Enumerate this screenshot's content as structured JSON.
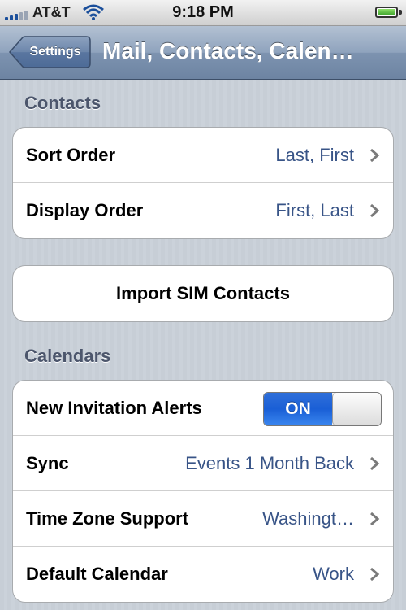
{
  "status_bar": {
    "carrier": "AT&T",
    "time": "9:18 PM",
    "signal_icon": "signal-bars-icon",
    "wifi_icon": "wifi-icon",
    "battery_icon": "battery-charging-icon"
  },
  "nav": {
    "back_label": "Settings",
    "title": "Mail, Contacts, Calen…"
  },
  "contacts_section": {
    "header": "Contacts",
    "rows": [
      {
        "label": "Sort Order",
        "value": "Last, First"
      },
      {
        "label": "Display Order",
        "value": "First, Last"
      }
    ]
  },
  "import_sim": {
    "label": "Import SIM Contacts"
  },
  "calendars_section": {
    "header": "Calendars",
    "invitation_alerts": {
      "label": "New Invitation Alerts",
      "toggle_text": "ON",
      "state": true
    },
    "rows": [
      {
        "label": "Sync",
        "value": "Events 1 Month Back"
      },
      {
        "label": "Time Zone Support",
        "value": "Washingt…"
      },
      {
        "label": "Default Calendar",
        "value": "Work"
      }
    ]
  },
  "colors": {
    "nav_bar": "#8fa3bd",
    "value_text": "#385487",
    "toggle_on": "#1a5fd6",
    "section_header": "#4c566c"
  }
}
